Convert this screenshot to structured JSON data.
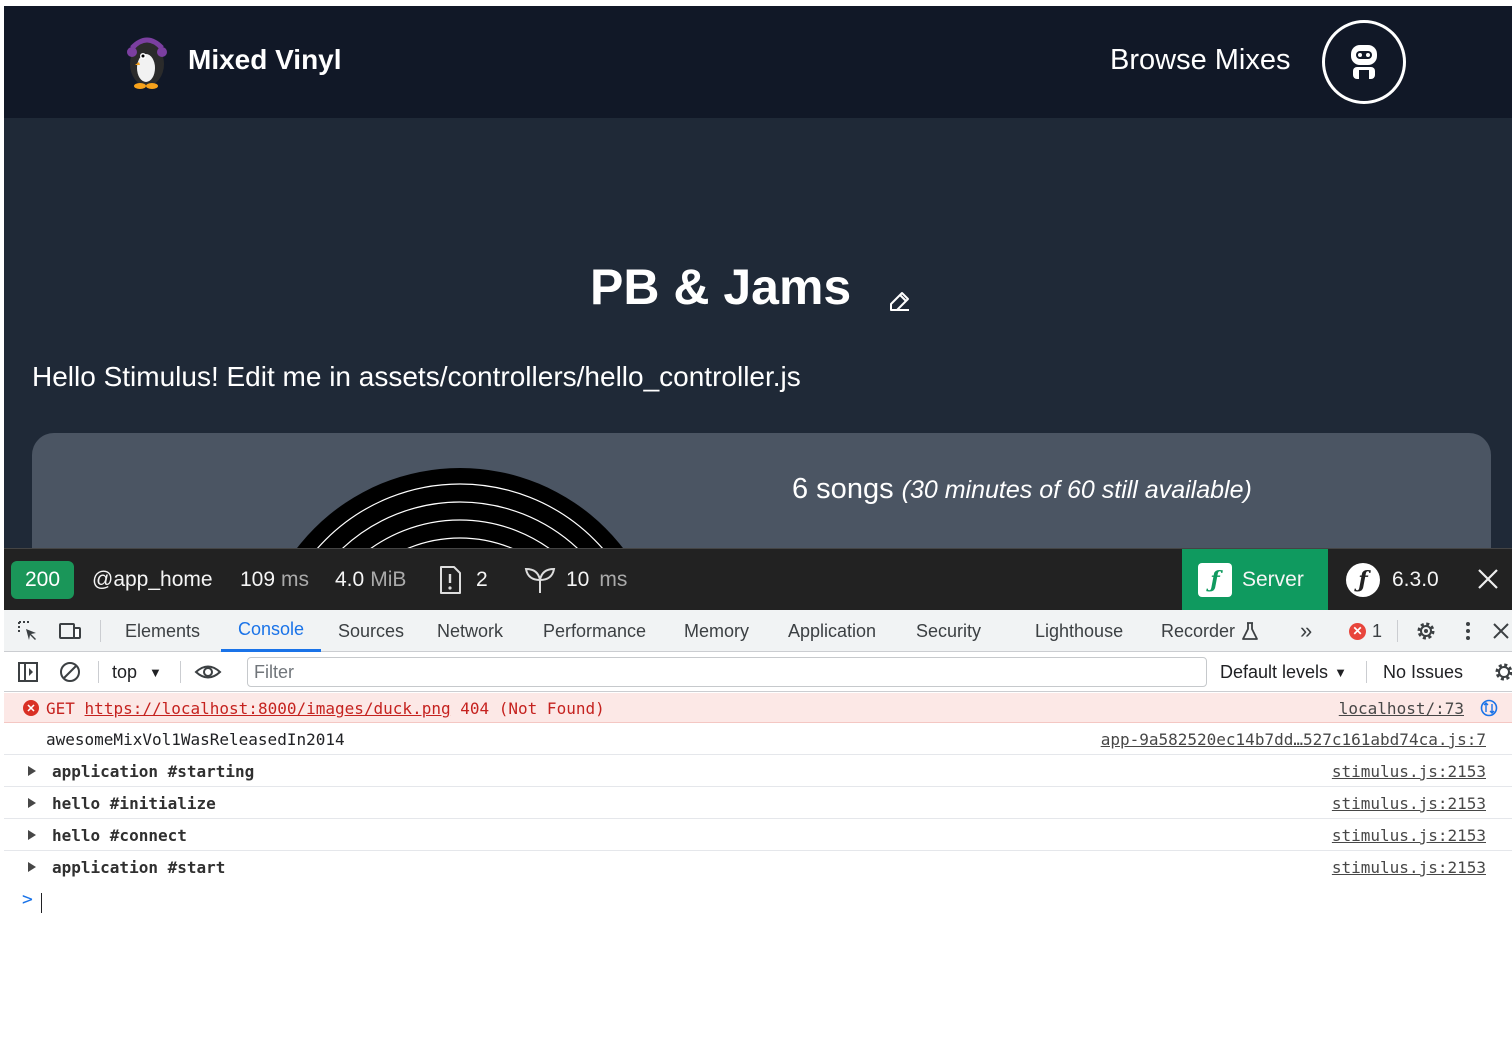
{
  "site": {
    "brand_name": "Mixed Vinyl",
    "nav_link": "Browse Mixes",
    "mix_title": "PB & Jams",
    "hello_text": "Hello Stimulus! Edit me in assets/controllers/hello_controller.js",
    "songs_count": "6 songs",
    "songs_available": "(30 minutes of 60 still available)",
    "colors": {
      "nav_bg": "#111827",
      "page_bg": "#1f2937",
      "card_bg": "#4b5563"
    }
  },
  "toolbar": {
    "status_code": "200",
    "route": "@app_home",
    "time_value": "109",
    "time_unit": "ms",
    "memory_value": "4.0",
    "memory_unit": "MiB",
    "logs_count": "2",
    "twig_value": "10",
    "twig_unit": "ms",
    "server_label": "Server",
    "version": "6.3.0",
    "logo_glyph": "sf",
    "colors": {
      "status": "#1a9659",
      "server": "#0f9a5f"
    }
  },
  "devtools": {
    "tabs": [
      "Elements",
      "Console",
      "Sources",
      "Network",
      "Performance",
      "Memory",
      "Application",
      "Security",
      "Lighthouse",
      "Recorder"
    ],
    "active_tab": "Console",
    "more_tabs_glyph": "»",
    "error_count": "1",
    "context": "top",
    "filter_placeholder": "Filter",
    "levels": "Default levels",
    "issues": "No Issues",
    "messages": {
      "error": {
        "method": "GET",
        "url": "https://localhost:8000/images/duck.png",
        "status": "404 (Not Found)",
        "source": "localhost/:73"
      },
      "log": {
        "text": "awesomeMixVol1WasReleasedIn2014",
        "source": "app-9a582520ec14b7dd…527c161abd74ca.js:7"
      },
      "groups": [
        {
          "text": "application #starting",
          "source": "stimulus.js:2153"
        },
        {
          "text": "hello #initialize",
          "source": "stimulus.js:2153"
        },
        {
          "text": "hello #connect",
          "source": "stimulus.js:2153"
        },
        {
          "text": "application #start",
          "source": "stimulus.js:2153"
        }
      ]
    },
    "prompt_glyph": ">"
  }
}
